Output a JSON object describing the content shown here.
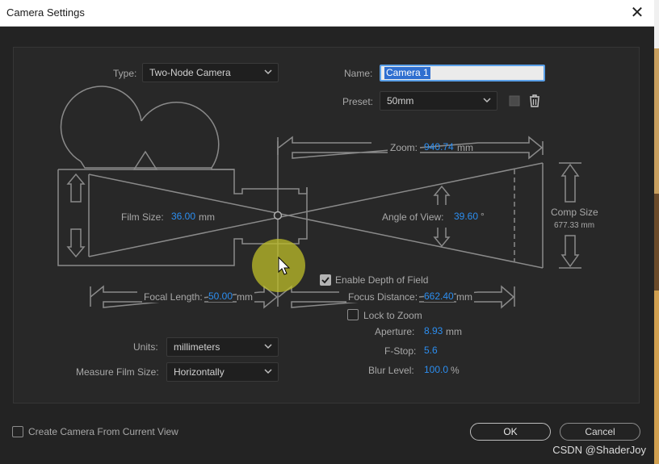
{
  "window": {
    "title": "Camera Settings"
  },
  "type": {
    "label": "Type:",
    "value": "Two-Node Camera"
  },
  "name": {
    "label": "Name:",
    "value": "Camera 1"
  },
  "preset": {
    "label": "Preset:",
    "value": "50mm"
  },
  "zoom": {
    "label": "Zoom:",
    "value": "940.74",
    "unit": "mm"
  },
  "film_size": {
    "label": "Film Size:",
    "value": "36.00",
    "unit": "mm"
  },
  "angle_of_view": {
    "label": "Angle of View:",
    "value": "39.60",
    "unit": "°"
  },
  "comp_size": {
    "label": "Comp Size",
    "value": "677.33 mm"
  },
  "focal_length": {
    "label": "Focal Length:",
    "value": "50.00",
    "unit": "mm"
  },
  "depth_of_field": {
    "label": "Enable Depth of Field",
    "checked": true
  },
  "focus_distance": {
    "label": "Focus Distance:",
    "value": "662.40",
    "unit": "mm"
  },
  "lock_to_zoom": {
    "label": "Lock to Zoom",
    "checked": false
  },
  "aperture": {
    "label": "Aperture:",
    "value": "8.93",
    "unit": "mm"
  },
  "fstop": {
    "label": "F-Stop:",
    "value": "5.6"
  },
  "blur_level": {
    "label": "Blur Level:",
    "value": "100.0",
    "unit": "%"
  },
  "units": {
    "label": "Units:",
    "value": "millimeters"
  },
  "measure_film_size": {
    "label": "Measure Film Size:",
    "value": "Horizontally"
  },
  "create_from_view": {
    "label": "Create Camera From Current View",
    "checked": false
  },
  "buttons": {
    "ok": "OK",
    "cancel": "Cancel"
  },
  "watermark": "CSDN @ShaderJoy",
  "colors": {
    "accent": "#2c8ef0",
    "background": "#232323",
    "panel": "#282828",
    "line": "#8a8a8a"
  }
}
